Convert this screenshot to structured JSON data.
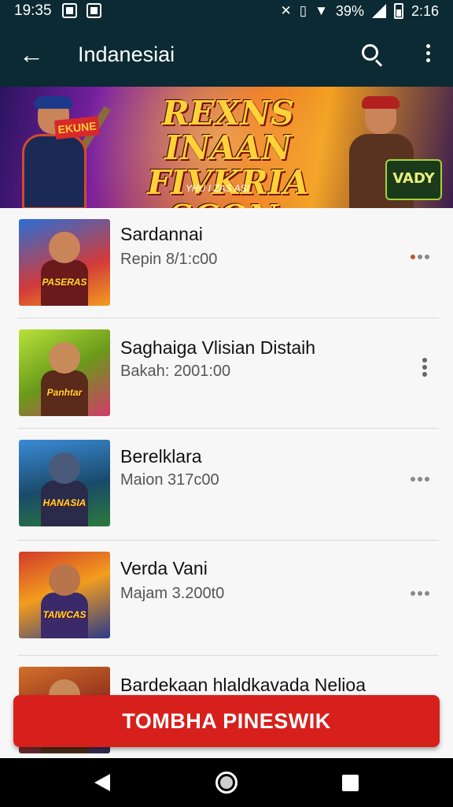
{
  "status_bar": {
    "time": "19:35",
    "battery_text": "39%",
    "clock_right": "2:16",
    "icons": [
      "image-notification-icon",
      "image-notification-icon",
      "mute-icon",
      "vibrate-icon",
      "wifi-icon",
      "signal-icon",
      "battery-icon"
    ]
  },
  "app_bar": {
    "title": "Indanesiai",
    "back_icon": "arrow-back-icon",
    "search_icon": "search-icon",
    "menu_icon": "more-vert-icon"
  },
  "banner": {
    "headline_line1": "REXNS INAAN",
    "headline_line2": "FIVKRIA SCON.",
    "subtitle": "YHU I ZAS ASI",
    "left_logo": "EKUNE",
    "badge": "VADY"
  },
  "items": [
    {
      "title": "Sardannai",
      "subtitle": "Repin 8/1:c00",
      "thumb_label": "PASERAS",
      "more_icon": "more-horiz-icon"
    },
    {
      "title": "Saghaiga Vlisian Distaih",
      "subtitle": "Bakah: 2001:00",
      "thumb_label": "Panhtar",
      "more_icon": "more-vert-icon"
    },
    {
      "title": "Berelklara",
      "subtitle": "Maion 317c00",
      "thumb_label": "HANASIA",
      "more_icon": "more-horiz-icon"
    },
    {
      "title": "Verda Vani",
      "subtitle": "Majam 3.200t0",
      "thumb_label": "TAIWCAS",
      "more_icon": "more-horiz-icon"
    },
    {
      "title": "Bardekaan hlaldkavada Nelioa",
      "subtitle": "",
      "thumb_label": "",
      "more_icon": ""
    }
  ],
  "cta": {
    "label": "TOMBHA PINESWIK"
  },
  "nav_bar": {
    "icons": [
      "nav-back-icon",
      "nav-home-icon",
      "nav-recents-icon"
    ]
  },
  "colors": {
    "app_bar": "#0b2a33",
    "cta": "#d7201c",
    "nav_bar": "#000000"
  }
}
